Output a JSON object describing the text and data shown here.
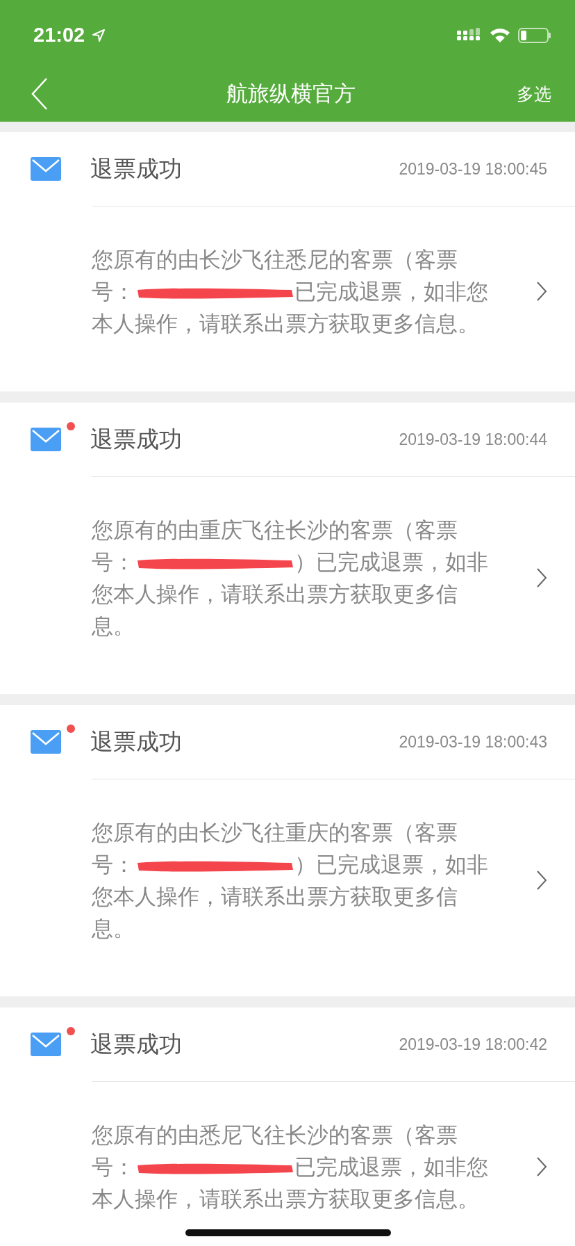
{
  "status_bar": {
    "time": "21:02"
  },
  "nav": {
    "title": "航旅纵横官方",
    "action": "多选"
  },
  "messages": [
    {
      "title": "退票成功",
      "time": "2019-03-19 18:00:45",
      "unread": false,
      "body_before": "您原有的由长沙飞往悉尼的客票（客票号：",
      "body_after": "已完成退票，如非您本人操作，请联系出票方获取更多信息。"
    },
    {
      "title": "退票成功",
      "time": "2019-03-19 18:00:44",
      "unread": true,
      "body_before": "您原有的由重庆飞往长沙的客票（客票号：",
      "body_after": "）已完成退票，如非您本人操作，请联系出票方获取更多信息。"
    },
    {
      "title": "退票成功",
      "time": "2019-03-19 18:00:43",
      "unread": true,
      "body_before": "您原有的由长沙飞往重庆的客票（客票号：",
      "body_after": "）已完成退票，如非您本人操作，请联系出票方获取更多信息。"
    },
    {
      "title": "退票成功",
      "time": "2019-03-19 18:00:42",
      "unread": true,
      "body_before": "您原有的由悉尼飞往长沙的客票（客票号：",
      "body_after": "已完成退票，如非您本人操作，请联系出票方获取更多信息。"
    }
  ]
}
